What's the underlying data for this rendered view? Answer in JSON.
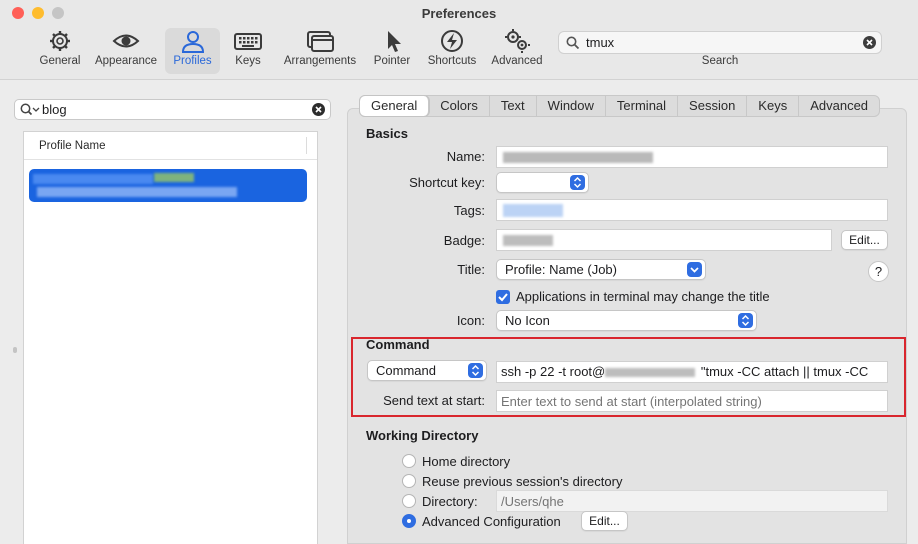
{
  "window": {
    "title": "Preferences"
  },
  "toolbar": {
    "items": [
      {
        "label": "General",
        "icon": "gear-icon"
      },
      {
        "label": "Appearance",
        "icon": "eye-icon"
      },
      {
        "label": "Profiles",
        "icon": "person-icon",
        "selected": true
      },
      {
        "label": "Keys",
        "icon": "keyboard-icon"
      },
      {
        "label": "Arrangements",
        "icon": "windows-icon"
      },
      {
        "label": "Pointer",
        "icon": "pointer-icon"
      },
      {
        "label": "Shortcuts",
        "icon": "bolt-icon"
      },
      {
        "label": "Advanced",
        "icon": "gears-icon"
      }
    ],
    "search": {
      "value": "tmux",
      "label": "Search"
    }
  },
  "profiles": {
    "search_value": "blog",
    "column_header": "Profile Name"
  },
  "tabs": [
    "General",
    "Colors",
    "Text",
    "Window",
    "Terminal",
    "Session",
    "Keys",
    "Advanced"
  ],
  "basics": {
    "heading": "Basics",
    "name_label": "Name:",
    "shortcut_label": "Shortcut key:",
    "tags_label": "Tags:",
    "badge_label": "Badge:",
    "badge_edit": "Edit...",
    "title_label": "Title:",
    "title_value": "Profile: Name (Job)",
    "help": "?",
    "checkbox_label": "Applications in terminal may change the title",
    "icon_label": "Icon:",
    "icon_value": "No Icon"
  },
  "command": {
    "heading": "Command",
    "type_value": "Command",
    "cmd_prefix": "ssh -p 22  -t root@",
    "cmd_suffix": "\"tmux -CC attach || tmux -CC",
    "send_label": "Send text at start:",
    "send_placeholder": "Enter text to send at start (interpolated string)"
  },
  "workdir": {
    "heading": "Working Directory",
    "opt_home": "Home directory",
    "opt_reuse": "Reuse previous session's directory",
    "opt_dir": "Directory:",
    "dir_placeholder": "/Users/qhe",
    "opt_advanced": "Advanced Configuration",
    "advanced_edit": "Edit..."
  },
  "colors": {
    "accent": "#2f6de1",
    "highlight": "#d9262e",
    "selection": "#1a64e0"
  }
}
